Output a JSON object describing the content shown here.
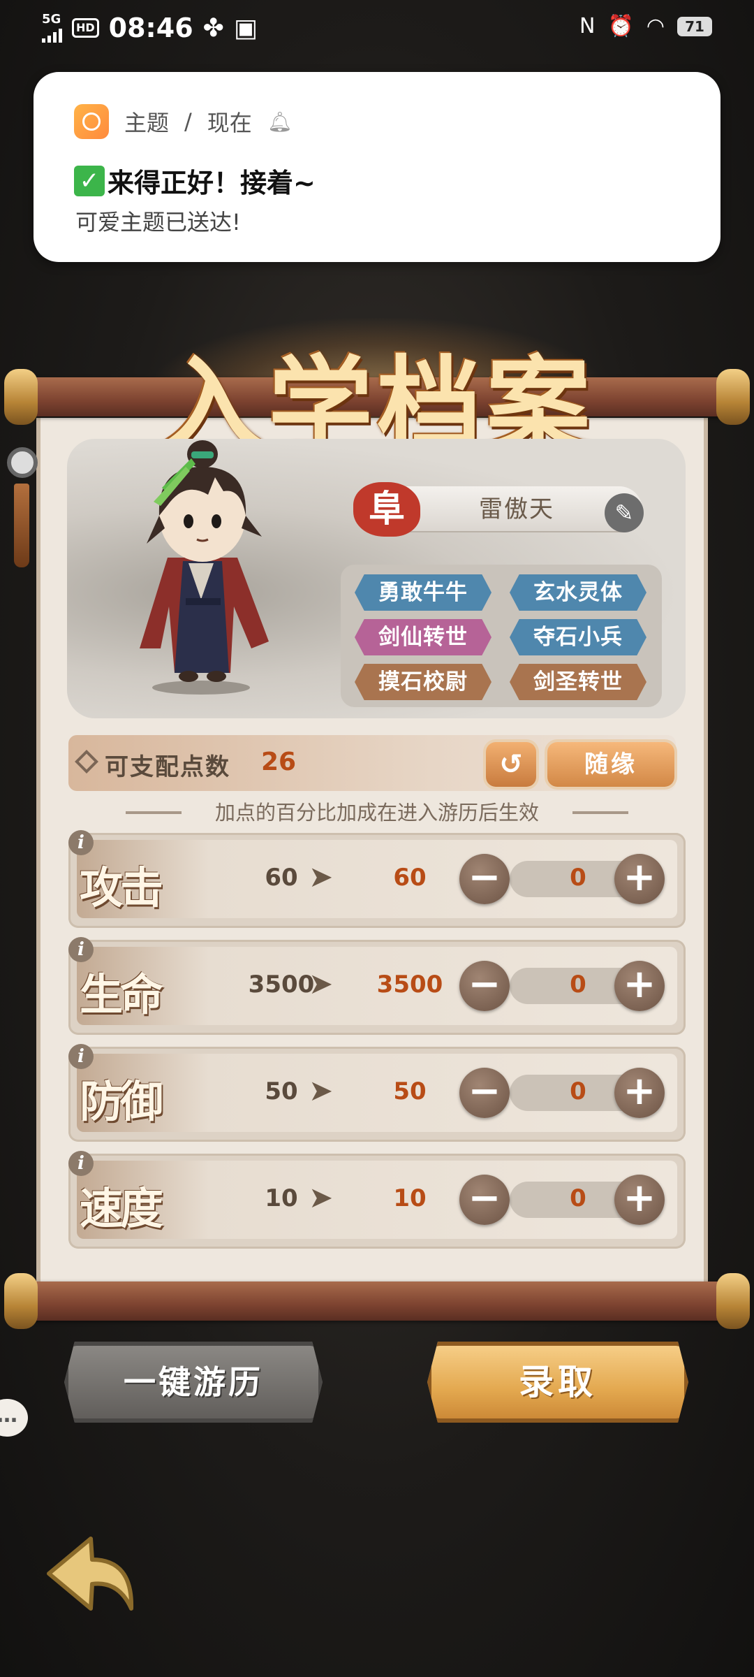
{
  "status_bar": {
    "network": "5G",
    "hd": "HD",
    "time": "08:46",
    "battery": "71"
  },
  "notification": {
    "app": "主题",
    "separator": "/",
    "when": "现在",
    "title": "来得正好！接着~",
    "body": "可爱主题已送达!"
  },
  "page": {
    "title": "入学档案"
  },
  "character": {
    "rank_seal": "阜",
    "name": "雷傲天",
    "traits": [
      {
        "label": "勇敢牛牛",
        "color": "#4f87ad"
      },
      {
        "label": "玄水灵体",
        "color": "#4f87ad"
      },
      {
        "label": "剑仙转世",
        "color": "#b66397"
      },
      {
        "label": "夺石小兵",
        "color": "#4f87ad"
      },
      {
        "label": "摸石校尉",
        "color": "#a9744f"
      },
      {
        "label": "剑圣转世",
        "color": "#a9744f"
      }
    ]
  },
  "points": {
    "label": "可支配点数",
    "value": "26",
    "random_label": "随缘",
    "hint": "加点的百分比加成在进入游历后生效"
  },
  "stats": [
    {
      "name": "攻击",
      "base": "60",
      "new": "60",
      "count": "0"
    },
    {
      "name": "生命",
      "base": "3500",
      "new": "3500",
      "count": "0"
    },
    {
      "name": "防御",
      "base": "50",
      "new": "50",
      "count": "0"
    },
    {
      "name": "速度",
      "base": "10",
      "new": "10",
      "count": "0"
    }
  ],
  "actions": {
    "travel_label": "一键游历",
    "enroll_label": "录取"
  }
}
